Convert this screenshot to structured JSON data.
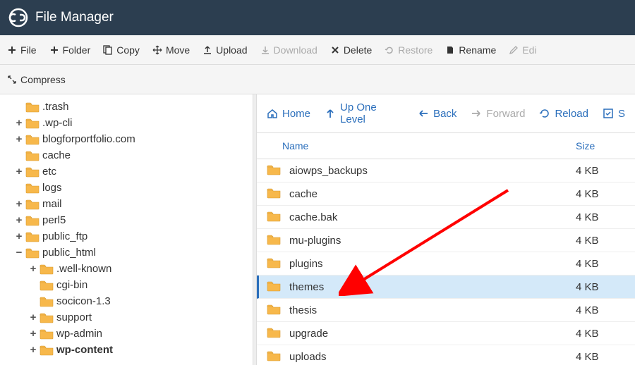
{
  "header": {
    "title": "File Manager"
  },
  "toolbar": {
    "file": "File",
    "folder": "Folder",
    "copy": "Copy",
    "move": "Move",
    "upload": "Upload",
    "download": "Download",
    "delete": "Delete",
    "restore": "Restore",
    "rename": "Rename",
    "edit": "Edi",
    "compress": "Compress"
  },
  "actions": {
    "home": "Home",
    "up": "Up One Level",
    "back": "Back",
    "forward": "Forward",
    "reload": "Reload",
    "select": "S"
  },
  "table": {
    "name_col": "Name",
    "size_col": "Size"
  },
  "tree": {
    "items": [
      {
        "toggle": "",
        "label": ".trash",
        "indent": 0
      },
      {
        "toggle": "+",
        "label": ".wp-cli",
        "indent": 0
      },
      {
        "toggle": "+",
        "label": "blogforportfolio.com",
        "indent": 0
      },
      {
        "toggle": "",
        "label": "cache",
        "indent": 0
      },
      {
        "toggle": "+",
        "label": "etc",
        "indent": 0
      },
      {
        "toggle": "",
        "label": "logs",
        "indent": 0
      },
      {
        "toggle": "+",
        "label": "mail",
        "indent": 0
      },
      {
        "toggle": "+",
        "label": "perl5",
        "indent": 0
      },
      {
        "toggle": "+",
        "label": "public_ftp",
        "indent": 0
      },
      {
        "toggle": "−",
        "label": "public_html",
        "indent": 0
      },
      {
        "toggle": "+",
        "label": ".well-known",
        "indent": 1
      },
      {
        "toggle": "",
        "label": "cgi-bin",
        "indent": 1
      },
      {
        "toggle": "",
        "label": "socicon-1.3",
        "indent": 1
      },
      {
        "toggle": "+",
        "label": "support",
        "indent": 1
      },
      {
        "toggle": "+",
        "label": "wp-admin",
        "indent": 1
      },
      {
        "toggle": "+",
        "label": "wp-content",
        "indent": 1,
        "bold": true
      }
    ]
  },
  "files": {
    "rows": [
      {
        "name": "aiowps_backups",
        "size": "4 KB"
      },
      {
        "name": "cache",
        "size": "4 KB"
      },
      {
        "name": "cache.bak",
        "size": "4 KB"
      },
      {
        "name": "mu-plugins",
        "size": "4 KB"
      },
      {
        "name": "plugins",
        "size": "4 KB"
      },
      {
        "name": "themes",
        "size": "4 KB",
        "selected": true
      },
      {
        "name": "thesis",
        "size": "4 KB"
      },
      {
        "name": "upgrade",
        "size": "4 KB"
      },
      {
        "name": "uploads",
        "size": "4 KB"
      }
    ]
  }
}
